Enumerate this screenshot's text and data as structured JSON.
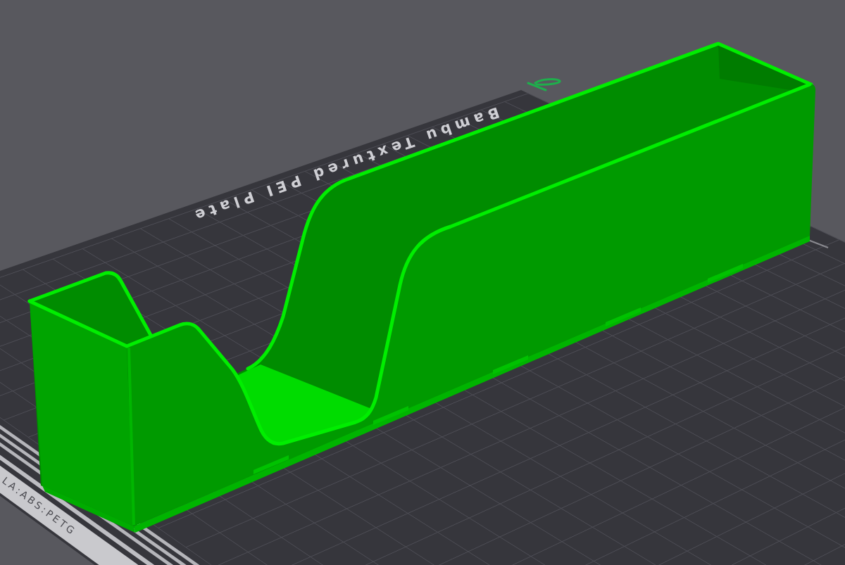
{
  "build_plate": {
    "name": "Bambu Textured PEI Plate",
    "filament_label": "LA:ABS:PETG"
  }
}
